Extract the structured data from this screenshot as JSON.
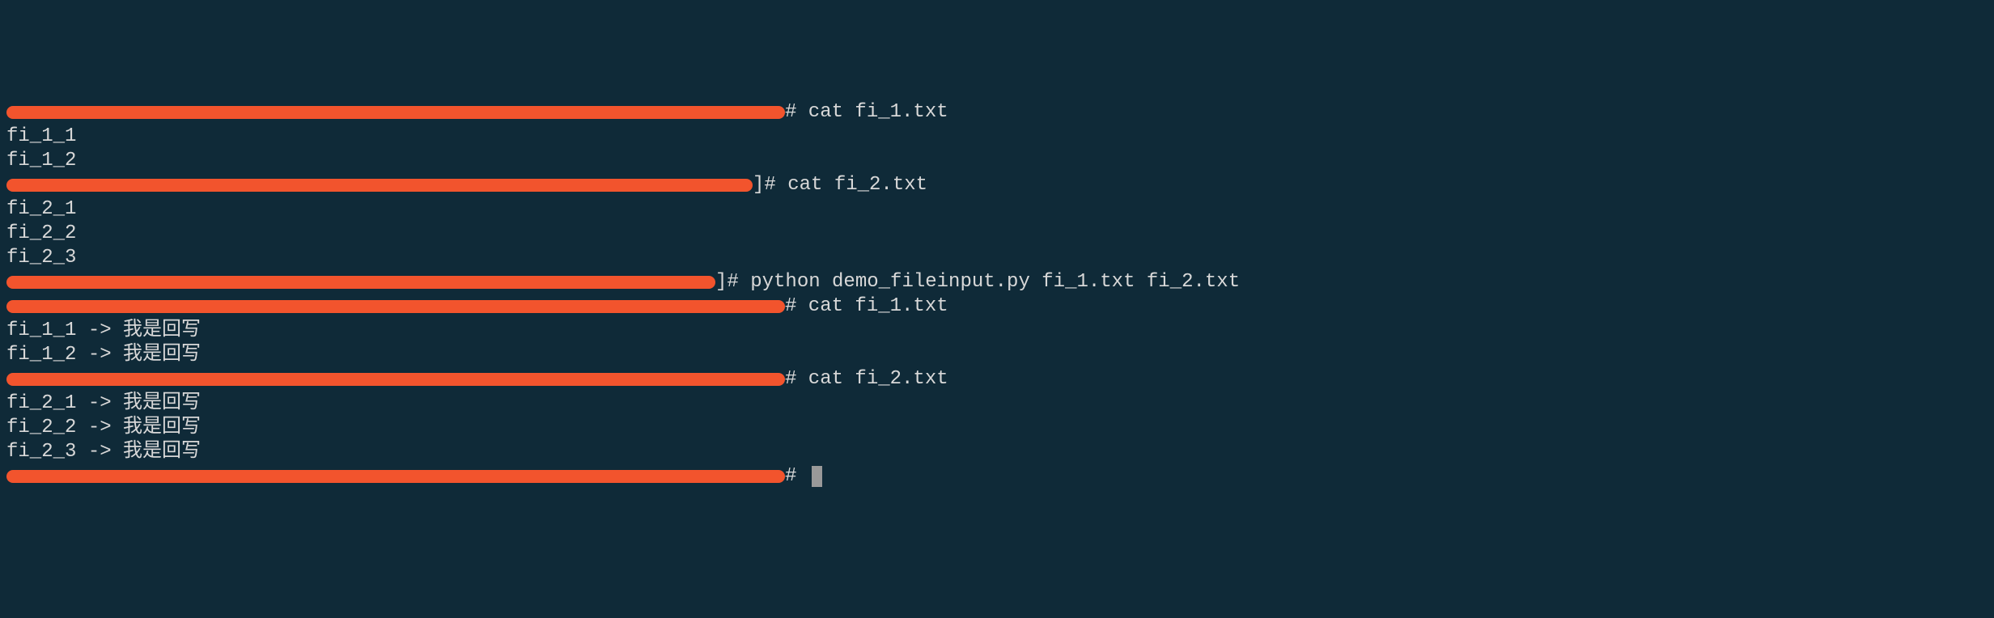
{
  "lines": [
    {
      "redactedWidth": 962,
      "text": "# cat fi_1.txt"
    },
    {
      "redactedWidth": 0,
      "text": "fi_1_1"
    },
    {
      "redactedWidth": 0,
      "text": "fi_1_2"
    },
    {
      "redactedWidth": 922,
      "text": "]# cat fi_2.txt"
    },
    {
      "redactedWidth": 0,
      "text": "fi_2_1"
    },
    {
      "redactedWidth": 0,
      "text": "fi_2_2"
    },
    {
      "redactedWidth": 0,
      "text": "fi_2_3"
    },
    {
      "redactedWidth": 876,
      "text": "]# python demo_fileinput.py fi_1.txt fi_2.txt"
    },
    {
      "redactedWidth": 962,
      "text": "# cat fi_1.txt"
    },
    {
      "redactedWidth": 0,
      "text": "fi_1_1 -> 我是回写"
    },
    {
      "redactedWidth": 0,
      "text": "fi_1_2 -> 我是回写"
    },
    {
      "redactedWidth": 962,
      "text": "# cat fi_2.txt"
    },
    {
      "redactedWidth": 0,
      "text": "fi_2_1 -> 我是回写"
    },
    {
      "redactedWidth": 0,
      "text": "fi_2_2 -> 我是回写"
    },
    {
      "redactedWidth": 0,
      "text": "fi_2_3 -> 我是回写"
    },
    {
      "redactedWidth": 962,
      "text": "# ",
      "cursor": true
    }
  ]
}
